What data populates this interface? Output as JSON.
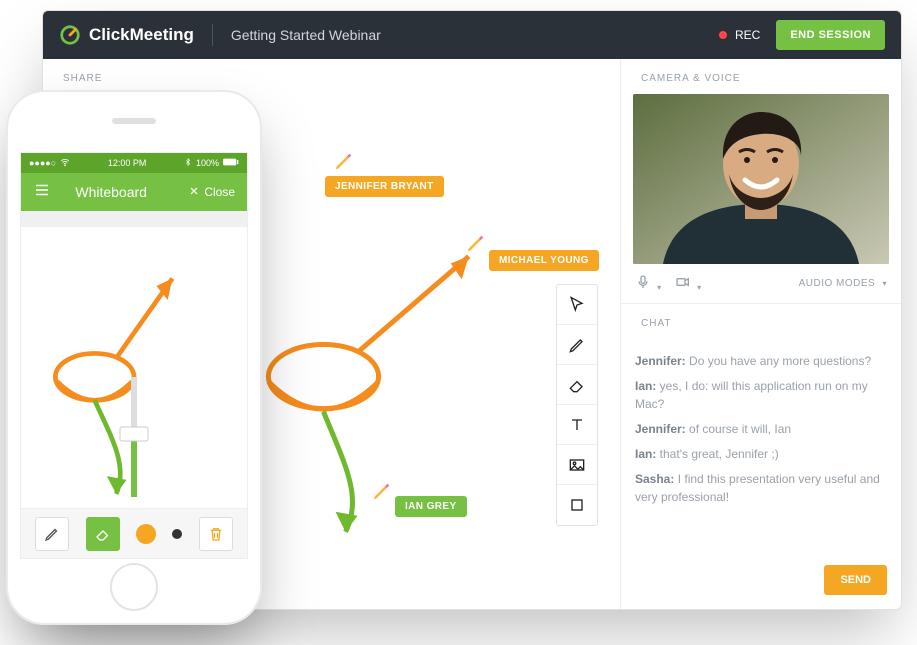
{
  "brand": {
    "name": "ClickMeeting"
  },
  "titlebar": {
    "webinar_title": "Getting Started Webinar",
    "rec_label": "REC",
    "end_session_label": "END SESSION"
  },
  "sections": {
    "share": "SHARE",
    "camera": "CAMERA & VOICE",
    "chat": "CHAT"
  },
  "av": {
    "audio_modes_label": "AUDIO MODES"
  },
  "chat": {
    "send_label": "SEND",
    "messages": [
      {
        "author": "Jennifer:",
        "text": " Do you have any more questions?"
      },
      {
        "author": "Ian:",
        "text": " yes, I do: will this application run on my Mac?"
      },
      {
        "author": "Jennifer:",
        "text": " of course it will, Ian"
      },
      {
        "author": "Ian:",
        "text": " that's great, Jennifer ;)"
      },
      {
        "author": "Sasha:",
        "text": " I find this presentation very useful and very professional!"
      }
    ]
  },
  "whiteboard_users": {
    "u0": "JENNIFER BRYANT",
    "u1": "MICHAEL YOUNG",
    "u2": "IAN GREY"
  },
  "tool_palette": {
    "t0": "cursor",
    "t1": "pencil",
    "t2": "eraser",
    "t3": "text",
    "t4": "image",
    "t5": "rectangle"
  },
  "phone": {
    "status": {
      "carrier_dots": "●●●●○",
      "wifi": "wifi",
      "time": "12:00 PM",
      "bt": "bt",
      "battery_label": "100%"
    },
    "appbar": {
      "title": "Whiteboard",
      "close_label": "Close"
    },
    "tool_colors": {
      "orange": "#f5a623",
      "dark": "#333333"
    }
  }
}
